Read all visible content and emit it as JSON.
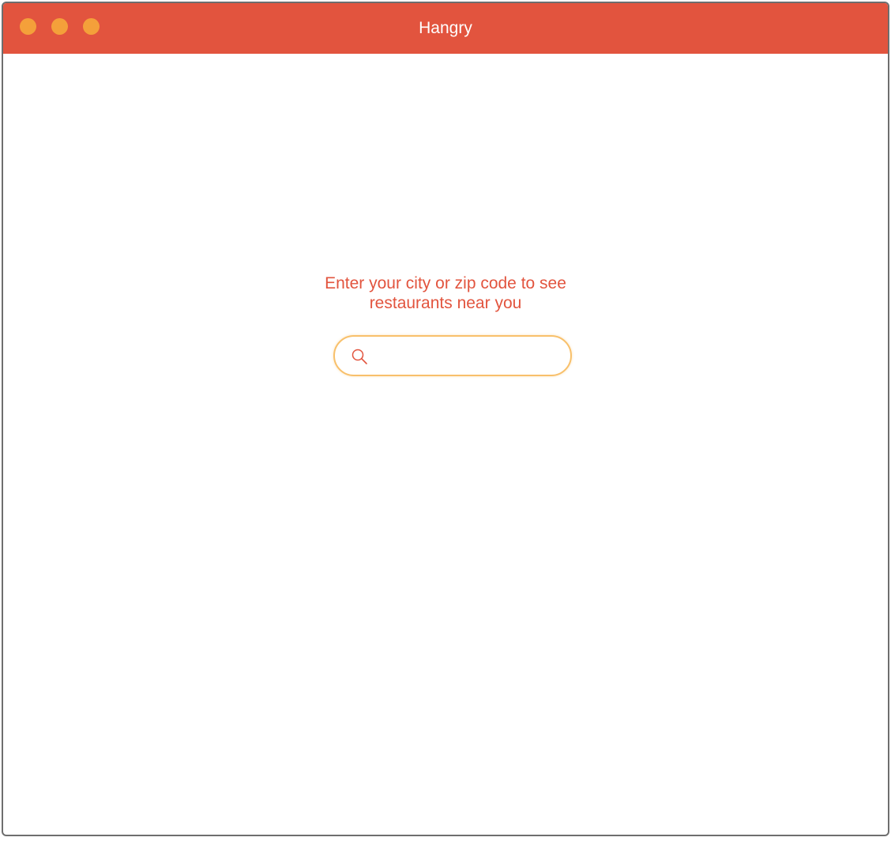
{
  "window": {
    "title": "Hangry",
    "titlebar_color": "#e2543e",
    "traffic_light_color": "#f4a03a"
  },
  "main": {
    "prompt_line1": "Enter your city or zip code to see",
    "prompt_line2": "restaurants near you",
    "prompt_color": "#e2543e"
  },
  "search": {
    "icon": "search-icon",
    "value": "",
    "placeholder": "",
    "border_color": "#f8c06b"
  }
}
